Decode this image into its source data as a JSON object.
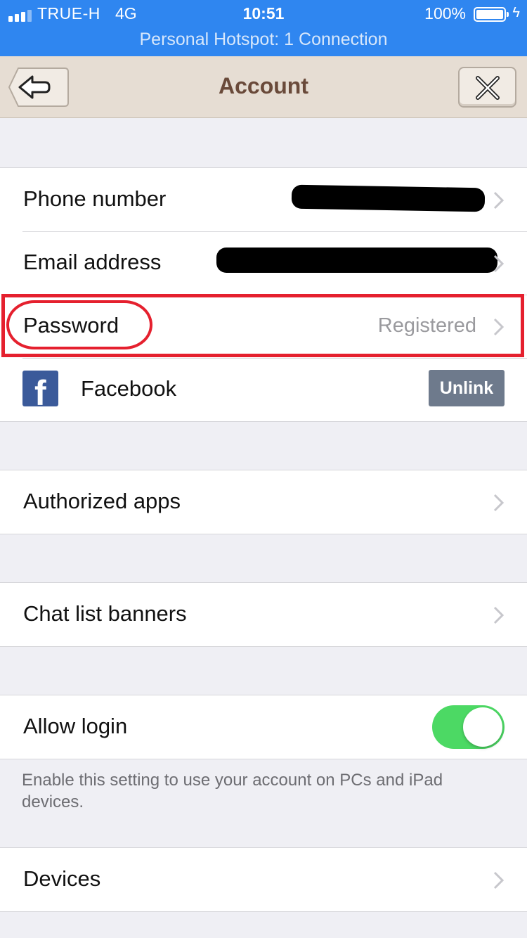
{
  "status_bar": {
    "carrier": "TRUE-H",
    "network": "4G",
    "time": "10:51",
    "battery": "100%",
    "hotspot": "Personal Hotspot: 1 Connection"
  },
  "nav": {
    "title": "Account",
    "back_icon": "back-arrow-icon",
    "close_icon": "close-icon"
  },
  "account_rows": {
    "phone": {
      "label": "Phone number"
    },
    "email": {
      "label": "Email address"
    },
    "password": {
      "label": "Password",
      "value": "Registered"
    },
    "facebook": {
      "label": "Facebook",
      "button": "Unlink",
      "icon": "facebook-icon"
    }
  },
  "authorized_apps": {
    "label": "Authorized apps"
  },
  "chat_list_banners": {
    "label": "Chat list banners"
  },
  "allow_login": {
    "label": "Allow login",
    "enabled": true,
    "hint": "Enable this setting to use your account on PCs and iPad devices."
  },
  "devices": {
    "label": "Devices"
  },
  "colors": {
    "status_bar": "#2f86f0",
    "nav_bar": "#e6ddd3",
    "title": "#6a4a3a",
    "toggle_on": "#4cd964",
    "highlight": "#e5202e",
    "facebook": "#3b5a9a"
  }
}
